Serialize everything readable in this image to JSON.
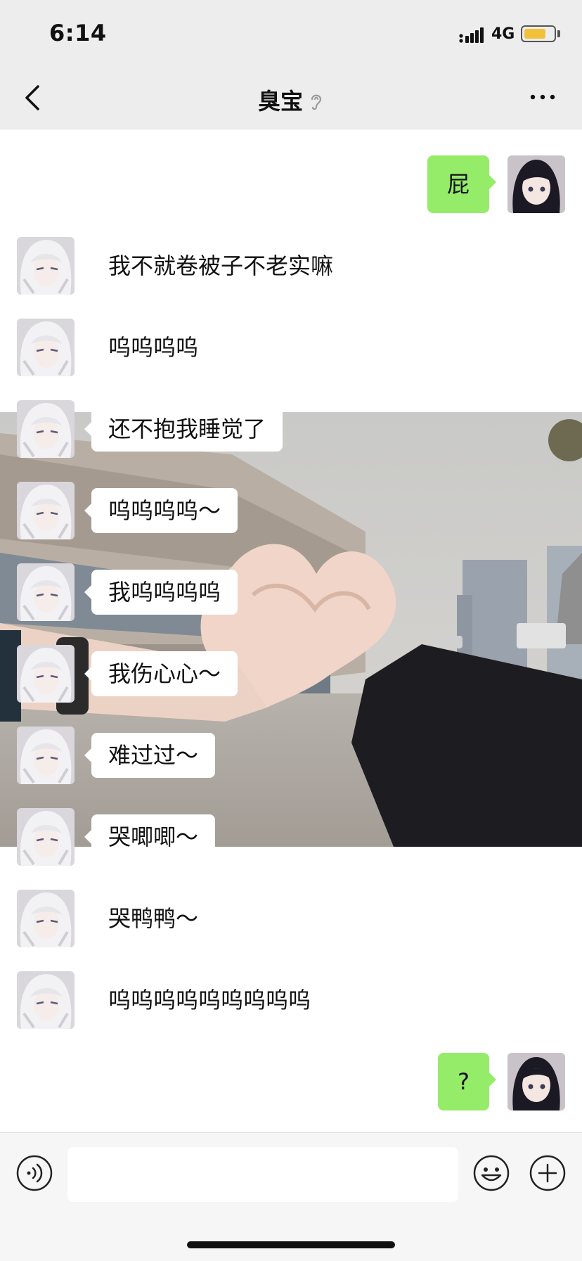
{
  "status_bar": {
    "time": "6:14",
    "network": "4G",
    "battery_level": 0.75,
    "battery_color": "#f2c13a"
  },
  "nav": {
    "title": "臭宝",
    "back_icon": "chevron-left-icon",
    "mute_icon": "ear-mute-icon",
    "more_icon": "more-dots-icon"
  },
  "messages": [
    {
      "side": "out",
      "text": "屁"
    },
    {
      "side": "in",
      "text": "我不就卷被子不老实嘛"
    },
    {
      "side": "in",
      "text": "呜呜呜呜"
    },
    {
      "side": "in",
      "text": "还不抱我睡觉了"
    },
    {
      "side": "in",
      "text": "呜呜呜呜～"
    },
    {
      "side": "in",
      "text": "我呜呜呜呜"
    },
    {
      "side": "in",
      "text": "我伤心心～"
    },
    {
      "side": "in",
      "text": "难过过～"
    },
    {
      "side": "in",
      "text": "哭唧唧～"
    },
    {
      "side": "in",
      "text": "哭鸭鸭～"
    },
    {
      "side": "in",
      "text": "呜呜呜呜呜呜呜呜呜"
    },
    {
      "side": "out",
      "text": "?"
    }
  ],
  "input_bar": {
    "placeholder": "",
    "voice_icon": "voice-icon",
    "emoji_icon": "emoji-icon",
    "plus_icon": "plus-icon"
  },
  "colors": {
    "outgoing_bubble": "#95ec69",
    "incoming_bubble": "#ffffff",
    "bar_background": "#ededed"
  }
}
